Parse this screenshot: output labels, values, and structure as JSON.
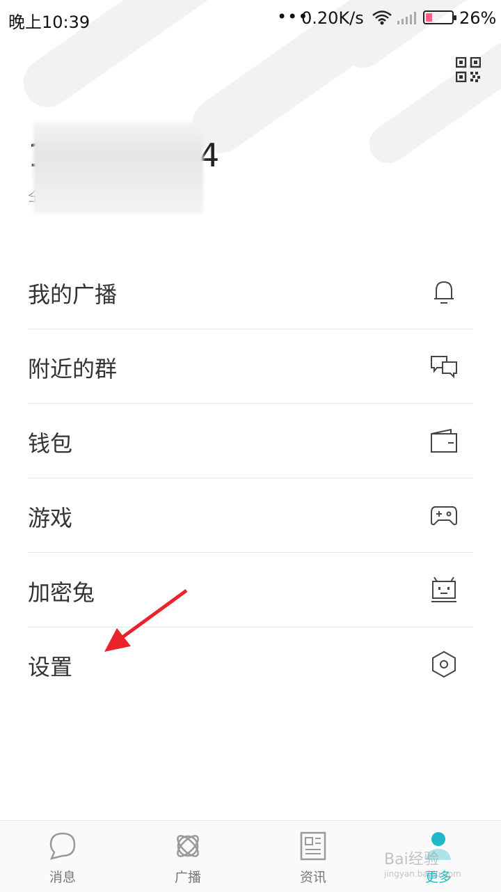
{
  "status_bar": {
    "time": "晚上10:39",
    "dots": "•••",
    "network_speed": "0.20K/s",
    "battery_level": 0.26,
    "battery_percent": "26%"
  },
  "header": {
    "qr_icon": "qr-code-icon"
  },
  "profile": {
    "name": "1",
    "name_end": "4",
    "subtitle": "仝"
  },
  "menu": [
    {
      "label": "我的广播",
      "icon": "bell-icon"
    },
    {
      "label": "附近的群",
      "icon": "chat-bubbles-icon"
    },
    {
      "label": "钱包",
      "icon": "wallet-icon"
    },
    {
      "label": "游戏",
      "icon": "gamepad-icon"
    },
    {
      "label": "加密兔",
      "icon": "robot-icon"
    },
    {
      "label": "设置",
      "icon": "settings-hexagon-icon"
    }
  ],
  "tabbar": {
    "tabs": [
      {
        "label": "消息",
        "icon": "message-bubble-icon"
      },
      {
        "label": "广播",
        "icon": "orbit-icon"
      },
      {
        "label": "资讯",
        "icon": "newspaper-icon"
      },
      {
        "label": "更多",
        "icon": "person-icon"
      }
    ],
    "active_color": "#1fb8c8"
  },
  "watermark": {
    "brand": "Bai",
    "brand_cn": "经验",
    "url": "jingyan.baidu.com"
  },
  "annotation": {
    "arrow_color": "#e8232a"
  }
}
